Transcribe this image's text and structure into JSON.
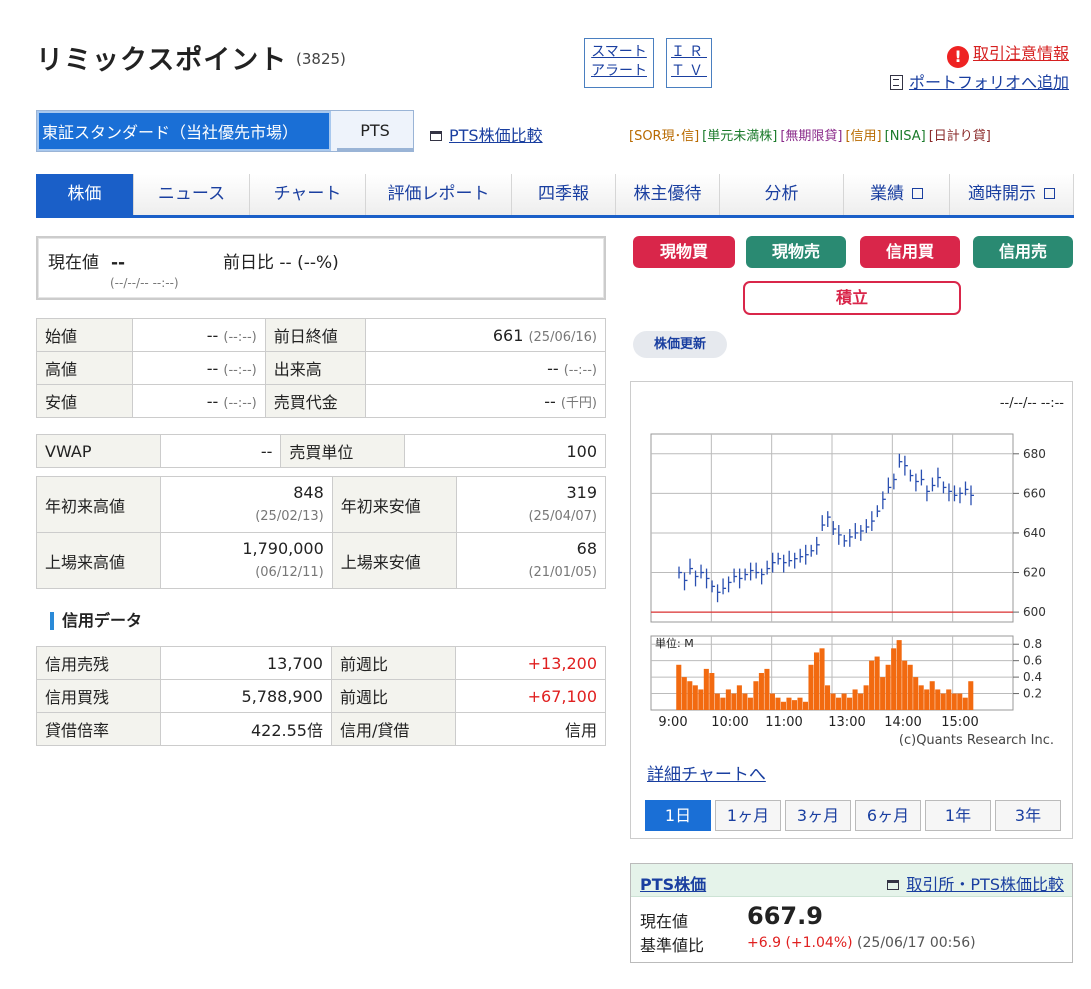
{
  "header": {
    "title": "リミックスポイント",
    "code": "(3825)",
    "smart_alert_l1": "スマート",
    "smart_alert_l2": "アラート",
    "ir_l1": "ＩＲ",
    "ir_l2": "ＴＶ",
    "caution": "取引注意情報",
    "portfolio": "ポートフォリオへ追加"
  },
  "market": {
    "main": "東証スタンダード（当社優先市場）",
    "pts": "PTS",
    "pts_compare": "PTS株価比較",
    "tags": [
      {
        "text": "[SOR現･信]",
        "color": "#b86a00"
      },
      {
        "text": "[単元未満株]",
        "color": "#1a7a2a"
      },
      {
        "text": "[無期限貸]",
        "color": "#8a2a8a"
      },
      {
        "text": "[信用]",
        "color": "#b86a00"
      },
      {
        "text": "[NISA]",
        "color": "#1a7a2a"
      },
      {
        "text": "[日計り貸]",
        "color": "#8a2a2a"
      }
    ]
  },
  "nav": [
    {
      "label": "株価"
    },
    {
      "label": "ニュース"
    },
    {
      "label": "チャート"
    },
    {
      "label": "評価レポート"
    },
    {
      "label": "四季報"
    },
    {
      "label": "株主優待"
    },
    {
      "label": "分析"
    },
    {
      "label": "業績"
    },
    {
      "label": "適時開示"
    }
  ],
  "current": {
    "label": "現在値",
    "value": "--",
    "change_label": "前日比 -- (--%)",
    "time": "(--/--/-- --:--)"
  },
  "prices": {
    "open_label": "始値",
    "open": "--",
    "open_t": "(--:--)",
    "prev_label": "前日終値",
    "prev": "661",
    "prev_t": "(25/06/16)",
    "high_label": "高値",
    "high": "--",
    "high_t": "(--:--)",
    "vol_label": "出来高",
    "vol": "--",
    "vol_t": "(--:--)",
    "low_label": "安値",
    "low": "--",
    "low_t": "(--:--)",
    "amt_label": "売買代金",
    "amt": "--",
    "amt_t": "(千円)"
  },
  "stats": {
    "vwap_label": "VWAP",
    "vwap": "--",
    "unit_label": "売買単位",
    "unit": "100",
    "yh_label": "年初来高値",
    "yh": "848",
    "yh_d": "(25/02/13)",
    "yl_label": "年初来安値",
    "yl": "319",
    "yl_d": "(25/04/07)",
    "lh_label": "上場来高値",
    "lh": "1,790,000",
    "lh_d": "(06/12/11)",
    "ll_label": "上場来安値",
    "ll": "68",
    "ll_d": "(21/01/05)"
  },
  "credit": {
    "title": "信用データ",
    "sell_label": "信用売残",
    "sell": "13,700",
    "sell_wk_label": "前週比",
    "sell_wk": "+13,200",
    "buy_label": "信用買残",
    "buy": "5,788,900",
    "buy_wk_label": "前週比",
    "buy_wk": "+67,100",
    "ratio_label": "貸借倍率",
    "ratio": "422.55倍",
    "type_label": "信用/貸借",
    "type": "信用"
  },
  "trade": {
    "buy": "現物買",
    "sell": "現物売",
    "cbuy": "信用買",
    "csell": "信用売",
    "tsumi": "積立",
    "refresh": "株価更新"
  },
  "chart_panel": {
    "date": "--/--/-- --:--",
    "detail_link": "詳細チャートへ",
    "periods": [
      "1日",
      "1ヶ月",
      "3ヶ月",
      "6ヶ月",
      "1年",
      "3年"
    ]
  },
  "chart_data": {
    "type": "line",
    "price_axis": {
      "ticks": [
        "680",
        "660",
        "640",
        "620",
        "600"
      ],
      "ylim": [
        595,
        690
      ],
      "ref_line": 600
    },
    "volume_axis": {
      "unit_label": "単位: M",
      "ticks": [
        "0.8",
        "0.6",
        "0.4",
        "0.2"
      ],
      "ylim": [
        0,
        0.9
      ]
    },
    "x_ticks": [
      "9:00",
      "10:00",
      "11:00",
      "13:00",
      "14:00",
      "15:00"
    ],
    "credit": "(c)Quants Research Inc.",
    "price": [
      620,
      616,
      622,
      618,
      620,
      617,
      613,
      610,
      612,
      615,
      618,
      617,
      619,
      621,
      620,
      619,
      622,
      625,
      627,
      625,
      626,
      627,
      628,
      629,
      631,
      634,
      644,
      648,
      642,
      639,
      636,
      638,
      640,
      641,
      643,
      646,
      651,
      657,
      663,
      667,
      676,
      674,
      669,
      666,
      667,
      661,
      664,
      668,
      663,
      661,
      659,
      660,
      662,
      659
    ],
    "volume": [
      0.55,
      0.4,
      0.35,
      0.3,
      0.25,
      0.5,
      0.45,
      0.2,
      0.15,
      0.25,
      0.2,
      0.3,
      0.2,
      0.15,
      0.35,
      0.45,
      0.5,
      0.2,
      0.15,
      0.1,
      0.15,
      0.12,
      0.15,
      0.1,
      0.55,
      0.7,
      0.75,
      0.3,
      0.2,
      0.15,
      0.2,
      0.15,
      0.25,
      0.2,
      0.3,
      0.6,
      0.65,
      0.4,
      0.55,
      0.75,
      0.85,
      0.6,
      0.55,
      0.4,
      0.3,
      0.25,
      0.35,
      0.25,
      0.2,
      0.25,
      0.2,
      0.2,
      0.15,
      0.35
    ]
  },
  "pts": {
    "title": "PTS株価",
    "compare": "取引所・PTS株価比較",
    "cur_label": "現在値",
    "cur": "667.9",
    "diff_label": "基準値比",
    "diff": "+6.9",
    "diff_pct": "(+1.04%)",
    "time": "(25/06/17 00:56)"
  }
}
